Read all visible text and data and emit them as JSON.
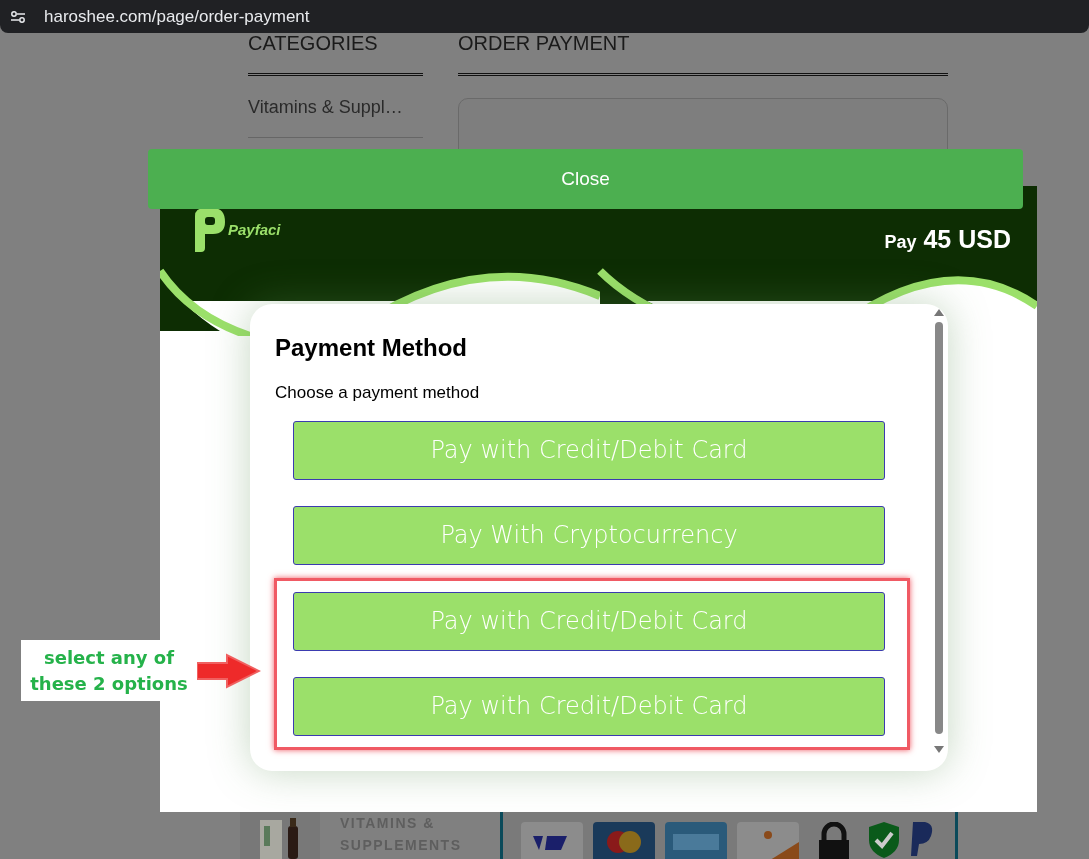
{
  "browser": {
    "url": "haroshee.com/page/order-payment"
  },
  "page": {
    "sidebar_heading": "CATEGORIES",
    "sidebar_items": [
      "Vitamins & Suppl…"
    ],
    "main_heading": "ORDER PAYMENT",
    "footer_category": "VITAMINS & SUPPLEMENTS"
  },
  "modal": {
    "close_button": "Close",
    "brand": "Payfaci",
    "pay_label": "Pay",
    "amount": "45 USD",
    "title": "Payment Method",
    "subtitle": "Choose a payment method",
    "options": [
      {
        "label": "Pay with Credit/Debit Card",
        "highlighted": false
      },
      {
        "label": "Pay With Cryptocurrency",
        "highlighted": false
      },
      {
        "label": "Pay with Credit/Debit Card",
        "highlighted": true
      },
      {
        "label": "Pay with Credit/Debit Card",
        "highlighted": true
      }
    ]
  },
  "annotation": {
    "text": "select any of these 2 options"
  }
}
